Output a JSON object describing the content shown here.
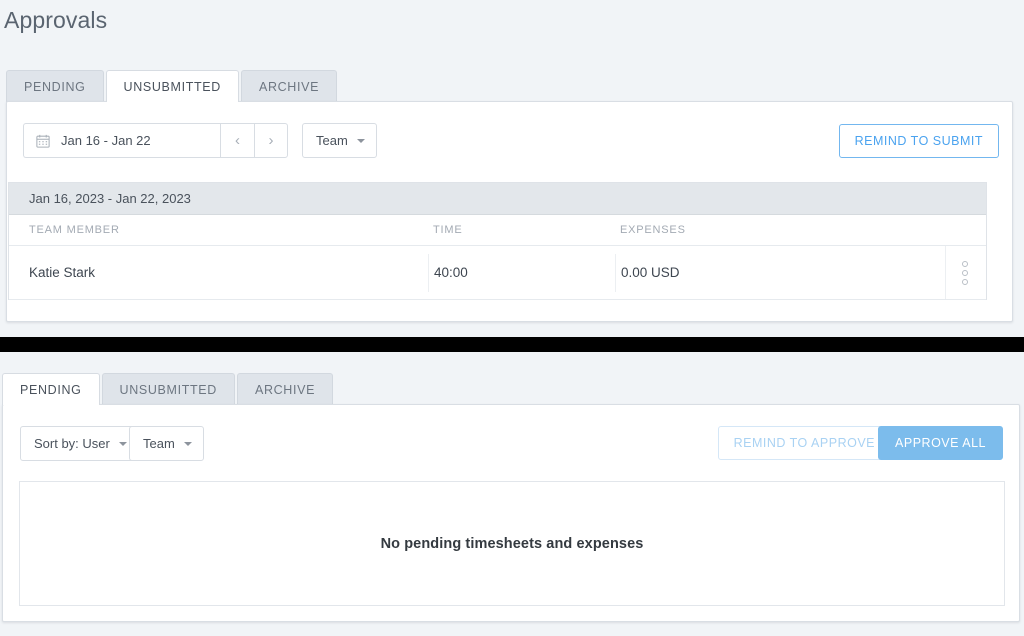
{
  "page": {
    "title": "Approvals",
    "background_color": "#f1f4f7",
    "accent_color": "#4ba3ef",
    "accent_fill_color": "#7cbcec"
  },
  "top_section": {
    "tabs": [
      {
        "label": "PENDING",
        "active": false
      },
      {
        "label": "UNSUBMITTED",
        "active": true
      },
      {
        "label": "ARCHIVE",
        "active": false
      }
    ],
    "toolbar": {
      "calendar_icon": "calendar-icon",
      "date_range_value": "Jan 16 - Jan 22",
      "prev_arrow": "‹",
      "next_arrow": "›",
      "team_filter_label": "Team",
      "remind_button_label": "REMIND TO SUBMIT"
    },
    "table": {
      "date_header": "Jan 16, 2023 - Jan 22, 2023",
      "columns": [
        "TEAM MEMBER",
        "TIME",
        "EXPENSES"
      ],
      "rows": [
        {
          "team_member": "Katie Stark",
          "time": "40:00",
          "expenses": "0.00 USD",
          "menu_icon": "more-vertical-icon"
        }
      ]
    }
  },
  "bottom_section": {
    "tabs": [
      {
        "label": "PENDING",
        "active": true
      },
      {
        "label": "UNSUBMITTED",
        "active": false
      },
      {
        "label": "ARCHIVE",
        "active": false
      }
    ],
    "toolbar": {
      "sort_by_label": "Sort by: User",
      "team_filter_label": "Team",
      "remind_button_label": "REMIND TO APPROVE",
      "approve_all_button_label": "APPROVE ALL"
    },
    "empty_state": {
      "message": "No pending timesheets and expenses"
    }
  }
}
